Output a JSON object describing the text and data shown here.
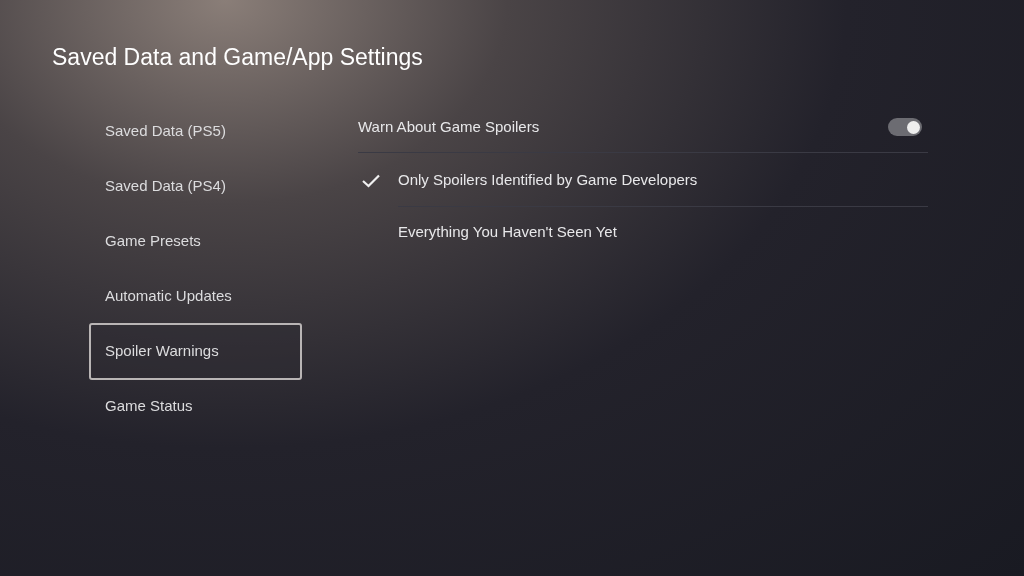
{
  "title": "Saved Data and Game/App Settings",
  "sidebar": {
    "items": [
      {
        "label": "Saved Data (PS5)",
        "selected": false
      },
      {
        "label": "Saved Data (PS4)",
        "selected": false
      },
      {
        "label": "Game Presets",
        "selected": false
      },
      {
        "label": "Automatic Updates",
        "selected": false
      },
      {
        "label": "Spoiler Warnings",
        "selected": true
      },
      {
        "label": "Game Status",
        "selected": false
      }
    ]
  },
  "settings": {
    "toggle": {
      "label": "Warn About Game Spoilers",
      "on": true
    },
    "options": [
      {
        "label": "Only Spoilers Identified by Game Developers",
        "selected": true
      },
      {
        "label": "Everything You Haven't Seen Yet",
        "selected": false
      }
    ]
  }
}
